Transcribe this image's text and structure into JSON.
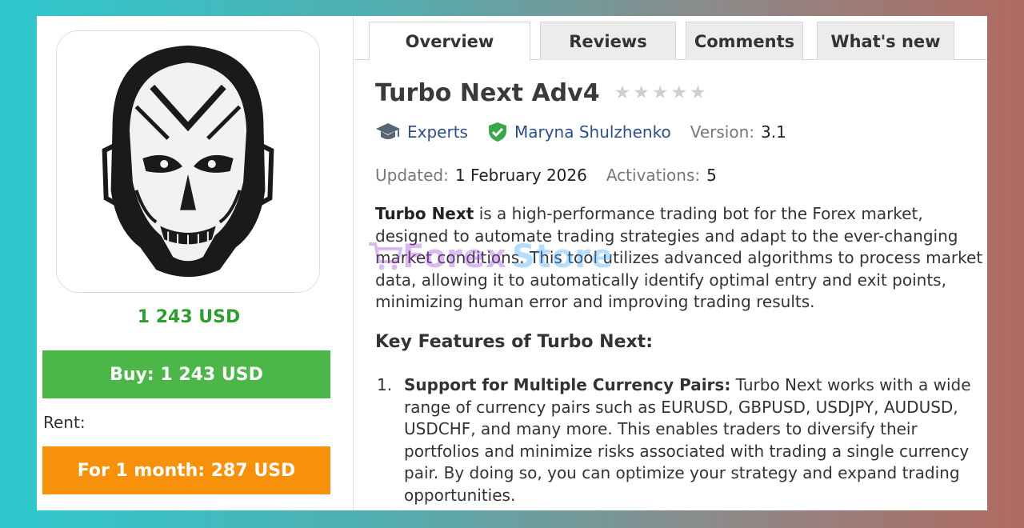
{
  "product": {
    "price": "1 243 USD",
    "buy_label": "Buy: 1 243 USD",
    "rent_label": "Rent:",
    "rent_button": "For 1 month: 287 USD"
  },
  "tabs": [
    {
      "label": "Overview",
      "active": true
    },
    {
      "label": "Reviews",
      "active": false
    },
    {
      "label": "Comments",
      "active": false
    },
    {
      "label": "What's new",
      "active": false
    }
  ],
  "header": {
    "title": "Turbo Next Adv4",
    "rating": 0,
    "category": "Experts",
    "author": "Maryna Shulzhenko",
    "version_label": "Version:",
    "version": "3.1",
    "updated_label": "Updated:",
    "updated": "1 February 2026",
    "activations_label": "Activations:",
    "activations": "5"
  },
  "description": {
    "bold": "Turbo Next",
    "text": " is a high-performance trading bot for the Forex market, designed to automate trading strategies and adapt to the ever-changing market conditions. This tool utilizes advanced algorithms to process market data, allowing it to automatically identify optimal entry and exit points, minimizing human error and improving trading results."
  },
  "features": {
    "heading": "Key Features of Turbo Next:",
    "items": [
      {
        "number": "1.",
        "title": "Support for Multiple Currency Pairs:",
        "text": " Turbo Next works with a wide range of currency pairs such as EURUSD, GBPUSD, USDJPY, AUDUSD, USDCHF, and many more. This enables traders to diversify their portfolios and minimize risks associated with trading a single currency pair. By doing so, you can optimize your strategy and expand trading opportunities."
      }
    ]
  },
  "watermark": {
    "part1": "Forex",
    "part2": "Store"
  },
  "colors": {
    "buy": "#4cb648",
    "rent": "#f7900a",
    "price": "#2e9f2e",
    "link": "#2f4f8a",
    "verified": "#3aa84a"
  }
}
